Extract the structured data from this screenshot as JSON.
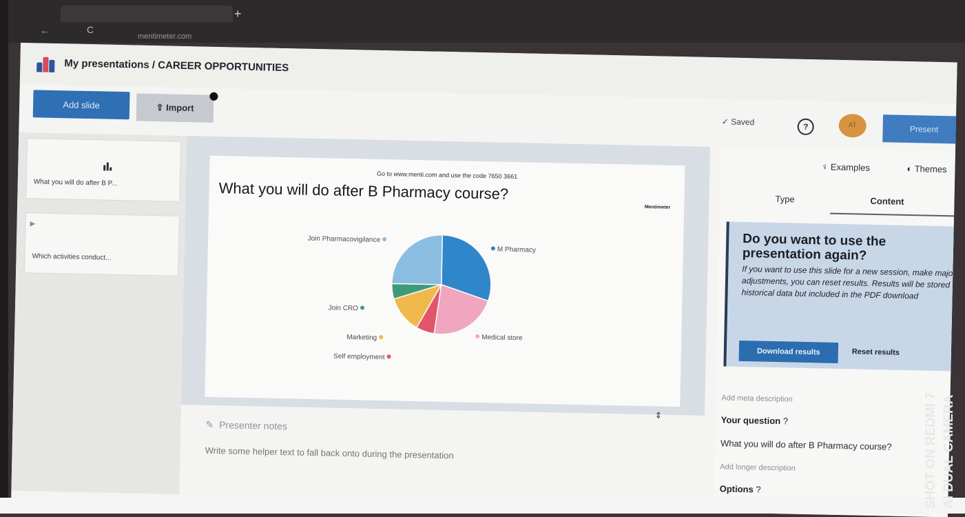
{
  "browser": {
    "tab_title": "",
    "url": "mentimeter.com"
  },
  "header": {
    "breadcrumb": "My presentations / CAREER OPPORTUNITIES",
    "add_slide": "Add slide",
    "import": "Import",
    "saved": "Saved",
    "avatar_initials": "AT",
    "present": "Present"
  },
  "slides": [
    {
      "label": "What you will do after B P..."
    },
    {
      "label": "Which activities conduct..."
    }
  ],
  "slide": {
    "join_instructions": "Go to www.menti.com and use the code 7650 3661",
    "title": "What you will do after B Pharmacy course?",
    "brand_mark": "Mentimeter"
  },
  "chart_data": {
    "type": "pie",
    "labels": [
      "M Pharmacy",
      "Medical store",
      "Self employment",
      "Marketing",
      "Join CRO",
      "Join Pharmacovigilance"
    ],
    "values": [
      30,
      22,
      6,
      12,
      5,
      25
    ],
    "colors": [
      "#2f86c9",
      "#f0a6bf",
      "#e2566a",
      "#f1b94b",
      "#3f9a7a",
      "#8bbde0"
    ]
  },
  "notes": {
    "title": "Presenter notes",
    "placeholder": "Write some helper text to fall back onto during the presentation"
  },
  "right_panel": {
    "examples": "Examples",
    "themes": "Themes",
    "tab_type": "Type",
    "tab_content": "Content",
    "info_title": "Do you want to use the presentation again?",
    "info_body": "If you want to use this slide for a new session, make major adjustments, you can reset results. Results will be stored as historical data but included in the PDF download",
    "download_results": "Download results",
    "reset_results": "Reset results",
    "add_meta": "Add meta description",
    "your_question": "Your question",
    "question_value": "What you will do after B Pharmacy course?",
    "add_longer": "Add longer description",
    "options": "Options"
  },
  "watermark": {
    "line1": "SHOT ON REDMI 7",
    "line2": "AI DUAL CAMERA"
  }
}
